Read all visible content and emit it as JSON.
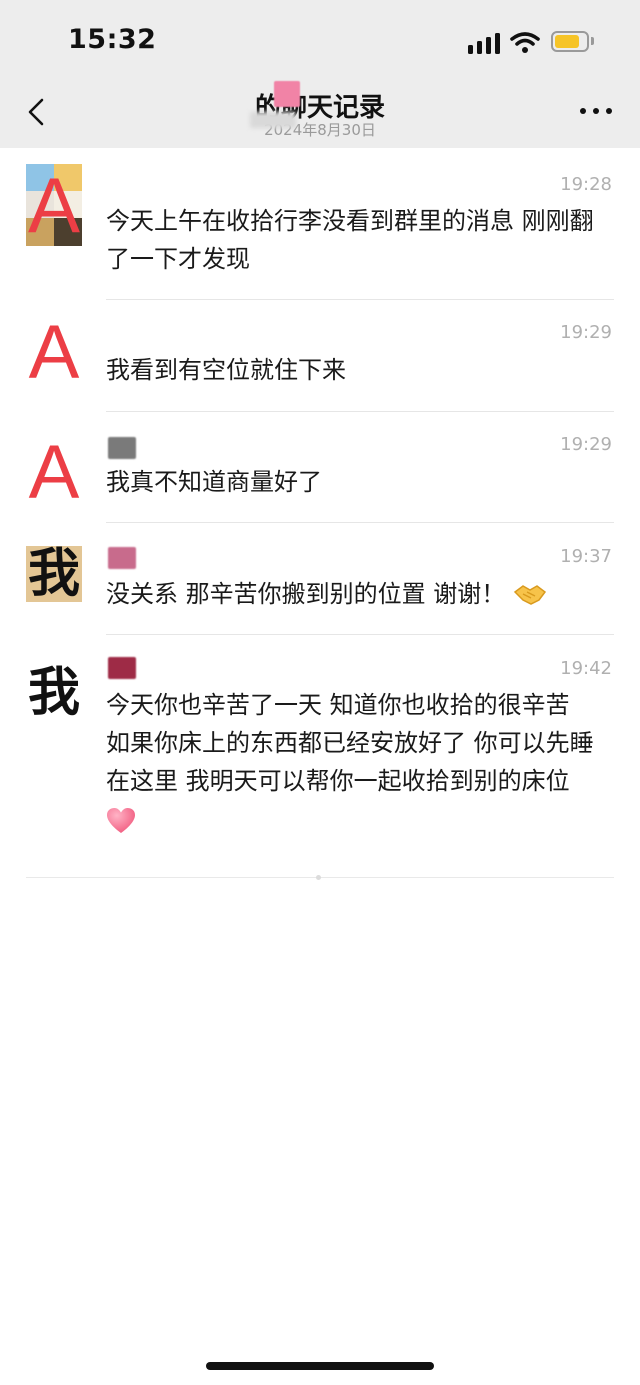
{
  "status_bar": {
    "time": "15:32"
  },
  "nav": {
    "title": "的聊天记录",
    "subtitle": "2024年8月30日"
  },
  "messages": [
    {
      "avatar": "A",
      "time": "19:28",
      "text": "今天上午在收拾行李没看到群里的消息 刚刚翻了一下才发现"
    },
    {
      "avatar": "A",
      "time": "19:29",
      "text": "我看到有空位就住下来"
    },
    {
      "avatar": "A",
      "time": "19:29",
      "text": "我真不知道商量好了"
    },
    {
      "avatar": "我",
      "time": "19:37",
      "text": "没关系 那辛苦你搬到别的位置 谢谢！",
      "emoji": "handshake-emoji"
    },
    {
      "avatar": "我",
      "time": "19:42",
      "text": "今天你也辛苦了一天 知道你也收拾的很辛苦 如果你床上的东西都已经安放好了 你可以先睡在这里 我明天可以帮你一起收拾到别的床位",
      "emoji": "heart-emoji"
    }
  ],
  "colors": {
    "header_bg": "#ededed",
    "letter_avatar": "#ec3e45",
    "timestamp": "#b0b0b0",
    "battery": "#f6c427",
    "sender_redaction": [
      "#7a7a7a",
      "#c86b8c",
      "#9e2b46"
    ]
  },
  "icons": [
    "chevron-left-icon",
    "more-dots-icon",
    "signal-icon",
    "wifi-icon",
    "battery-icon"
  ]
}
